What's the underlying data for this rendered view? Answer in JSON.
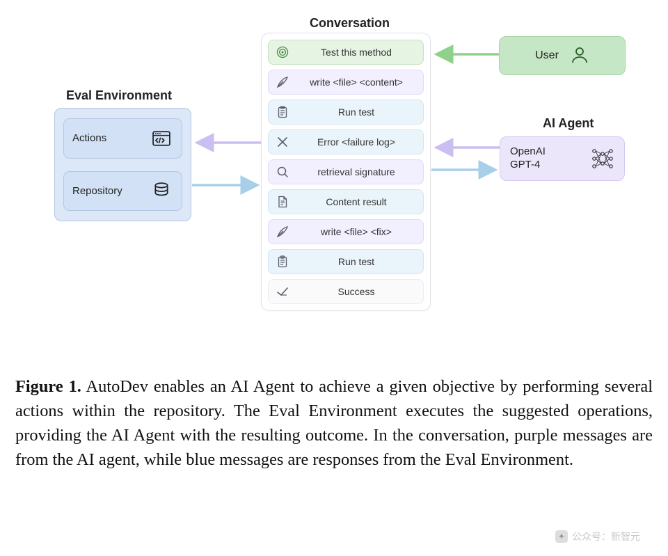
{
  "sections": {
    "eval_title": "Eval Environment",
    "conversation_title": "Conversation",
    "ai_agent_title": "AI Agent"
  },
  "eval": {
    "items": [
      {
        "label": "Actions",
        "icon": "code-window-icon"
      },
      {
        "label": "Repository",
        "icon": "database-icon"
      }
    ]
  },
  "user": {
    "label": "User"
  },
  "ai_agent": {
    "label": "OpenAI\nGPT-4"
  },
  "conversation": {
    "rows": [
      {
        "text": "Test this method",
        "icon": "target-icon",
        "kind": "green"
      },
      {
        "text": "write <file> <content>",
        "icon": "quill-icon",
        "kind": "purple"
      },
      {
        "text": "Run test",
        "icon": "clipboard-icon",
        "kind": "blue"
      },
      {
        "text": "Error <failure log>",
        "icon": "x-icon",
        "kind": "blue"
      },
      {
        "text": "retrieval signature",
        "icon": "search-icon",
        "kind": "purple"
      },
      {
        "text": "Content result",
        "icon": "document-icon",
        "kind": "blue"
      },
      {
        "text": "write <file> <fix>",
        "icon": "quill-icon",
        "kind": "purple"
      },
      {
        "text": "Run test",
        "icon": "clipboard-icon",
        "kind": "blue"
      },
      {
        "text": "Success",
        "icon": "check-icon",
        "kind": "white"
      }
    ]
  },
  "caption": {
    "label": "Figure 1.",
    "text": " AutoDev enables an AI Agent to achieve a given objective by performing several actions within the repository. The Eval Environment executes the suggested operations, providing the AI Agent with the resulting outcome. In the conversation, purple messages are from the AI agent, while blue messages are responses from the Eval Environment."
  },
  "watermark": {
    "text": "公众号：新智元"
  },
  "colors": {
    "eval_bg": "#dce7f7",
    "conv_green": "#e6f4e3",
    "conv_purple": "#f2efff",
    "conv_blue": "#eaf4fb",
    "user_bg": "#c6e7c5",
    "ai_bg": "#ece6fb"
  }
}
